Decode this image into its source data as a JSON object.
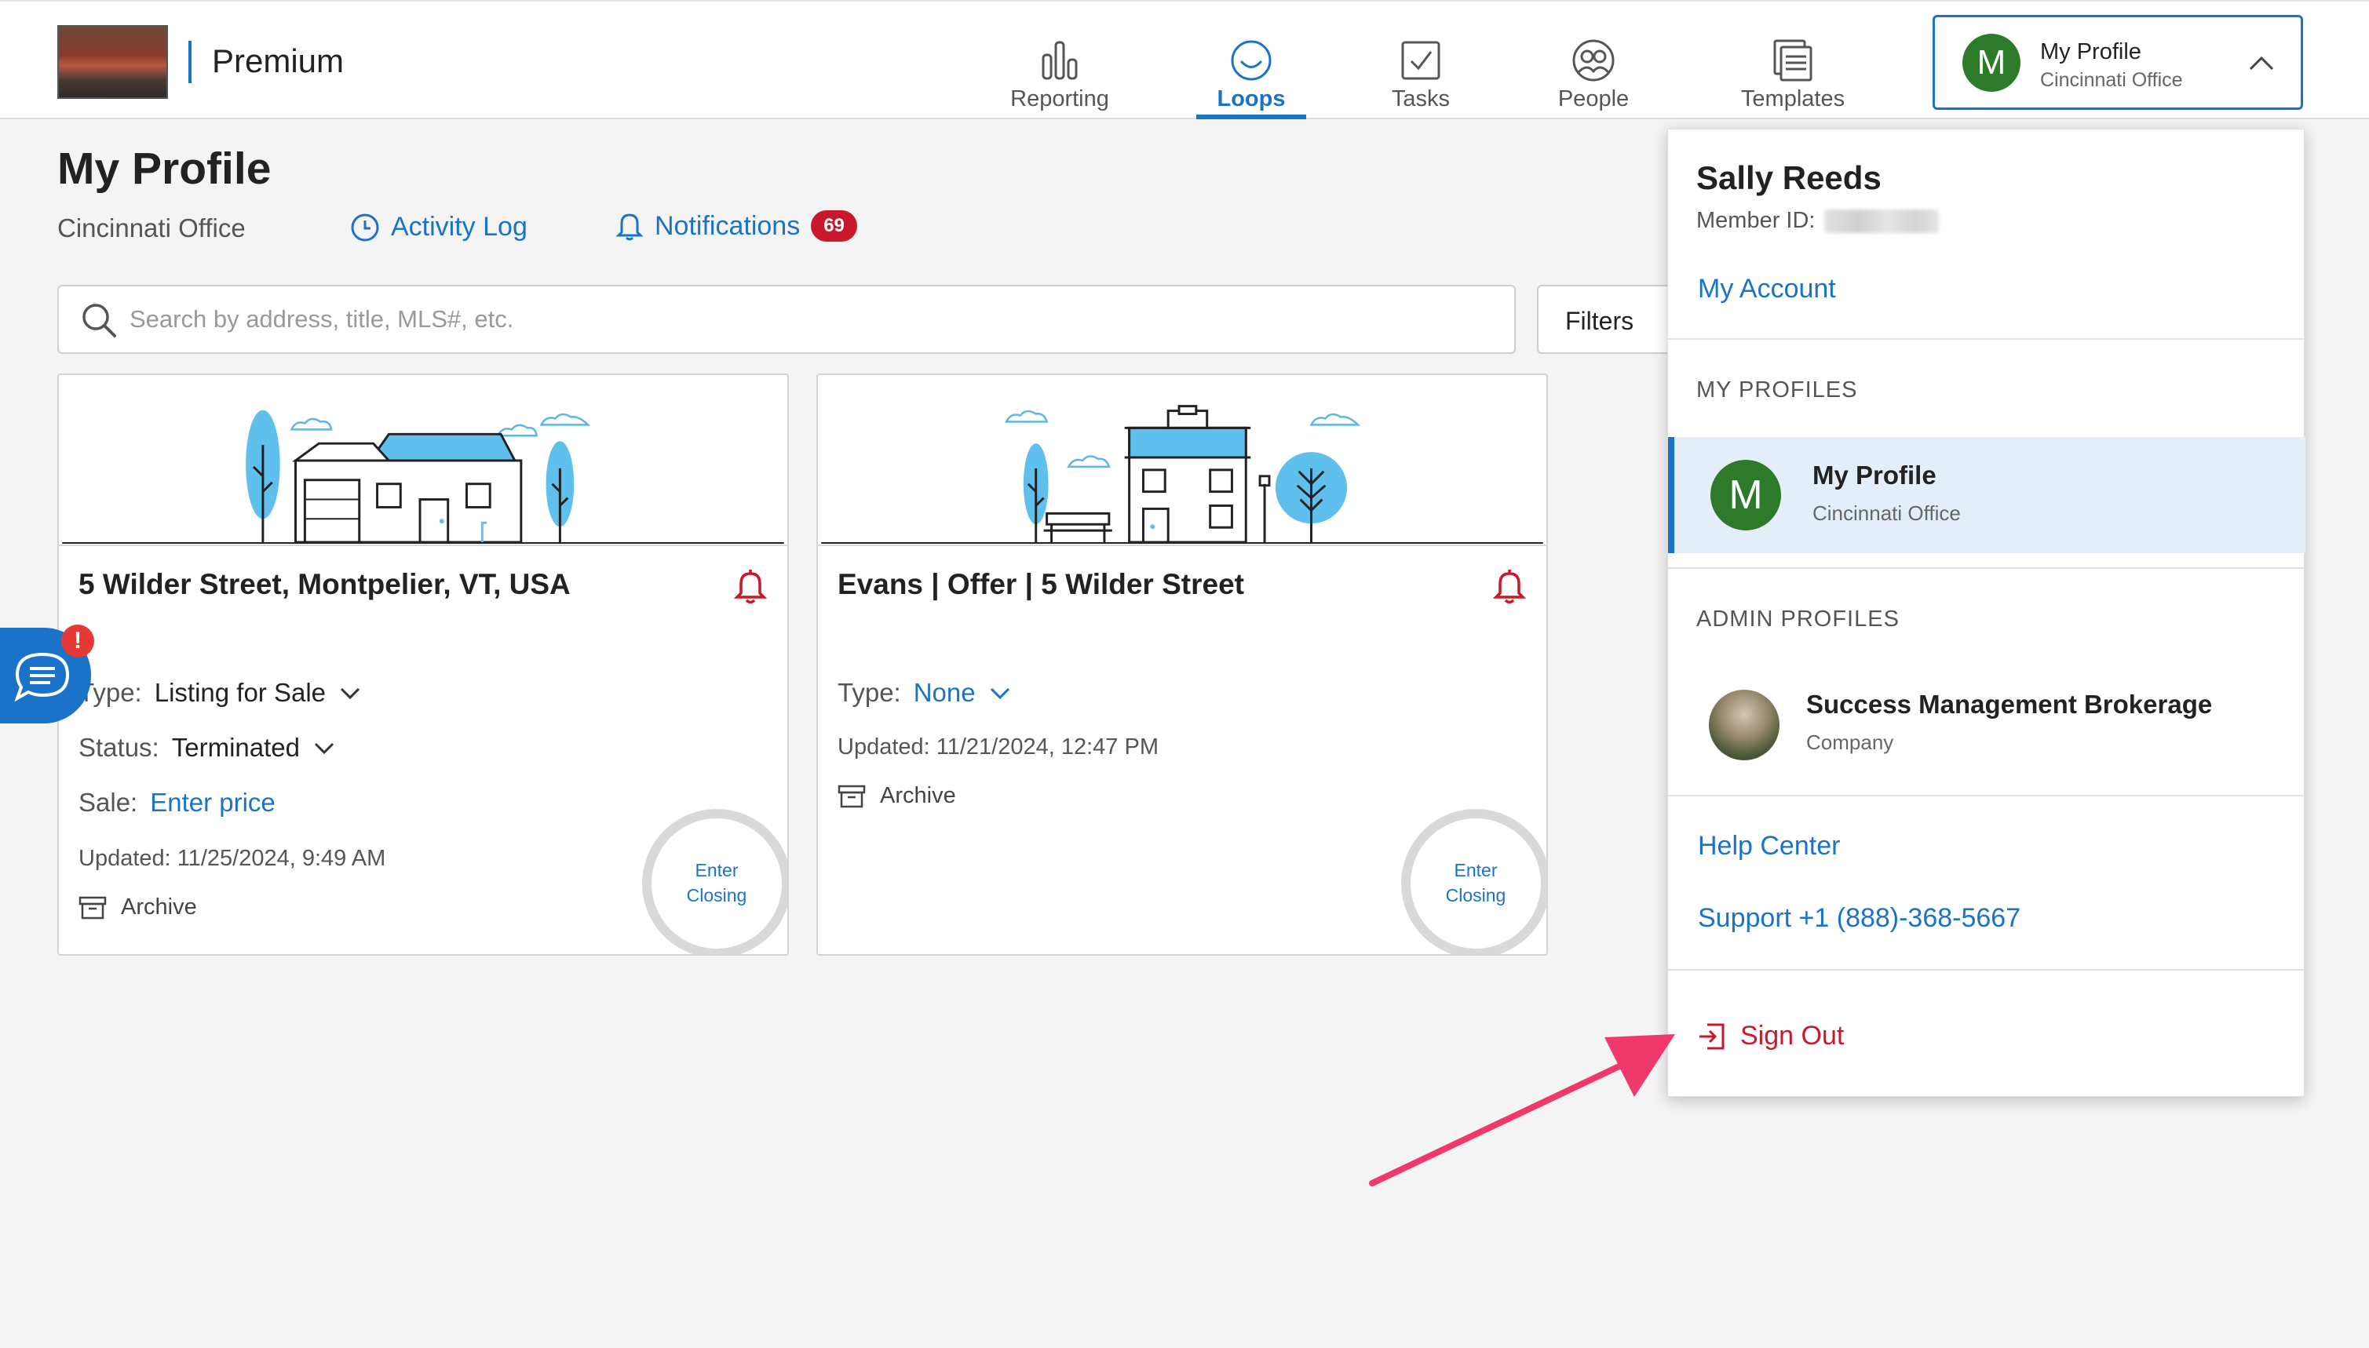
{
  "header": {
    "brand": "Premium",
    "nav": [
      {
        "label": "Reporting",
        "icon": "bar-chart-icon"
      },
      {
        "label": "Loops",
        "icon": "loops-icon",
        "active": true
      },
      {
        "label": "Tasks",
        "icon": "checkbox-icon"
      },
      {
        "label": "People",
        "icon": "people-icon"
      },
      {
        "label": "Templates",
        "icon": "templates-icon"
      }
    ],
    "profile": {
      "avatar_letter": "M",
      "name": "My Profile",
      "office": "Cincinnati Office"
    }
  },
  "page": {
    "title": "My Profile",
    "subtitle": "Cincinnati Office",
    "activity_log": "Activity Log",
    "notifications": "Notifications",
    "notifications_count": "69"
  },
  "search": {
    "placeholder": "Search by address, title, MLS#, etc.",
    "value": ""
  },
  "filters_label": "Filters",
  "cards": [
    {
      "title": "5 Wilder Street, Montpelier, VT, USA",
      "type_label": "Type:",
      "type_value": "Listing for Sale",
      "status_label": "Status:",
      "status_value": "Terminated",
      "sale_label": "Sale:",
      "sale_value": "Enter price",
      "updated": "Updated: 11/25/2024, 9:49 AM",
      "archive": "Archive",
      "closing_line1": "Enter",
      "closing_line2": "Closing"
    },
    {
      "title": "Evans | Offer | 5 Wilder Street",
      "type_label": "Type:",
      "type_value": "None",
      "updated": "Updated: 11/21/2024, 12:47 PM",
      "archive": "Archive",
      "closing_line1": "Enter",
      "closing_line2": "Closing"
    }
  ],
  "chat": {
    "alert": "!"
  },
  "dropdown": {
    "user_name": "Sally Reeds",
    "member_id_label": "Member ID:",
    "my_account": "My Account",
    "my_profiles_heading": "MY PROFILES",
    "my_profile": {
      "avatar_letter": "M",
      "name": "My Profile",
      "sub": "Cincinnati Office"
    },
    "admin_profiles_heading": "ADMIN PROFILES",
    "admin_profile": {
      "name": "Success Management Brokerage",
      "sub": "Company"
    },
    "help_center": "Help Center",
    "support": "Support +1 (888)-368-5667",
    "sign_out": "Sign Out"
  },
  "colors": {
    "accent": "#1a73c9",
    "danger": "#c9182b",
    "avatar_green": "#2d7a2b",
    "arrow": "#f0386b"
  }
}
